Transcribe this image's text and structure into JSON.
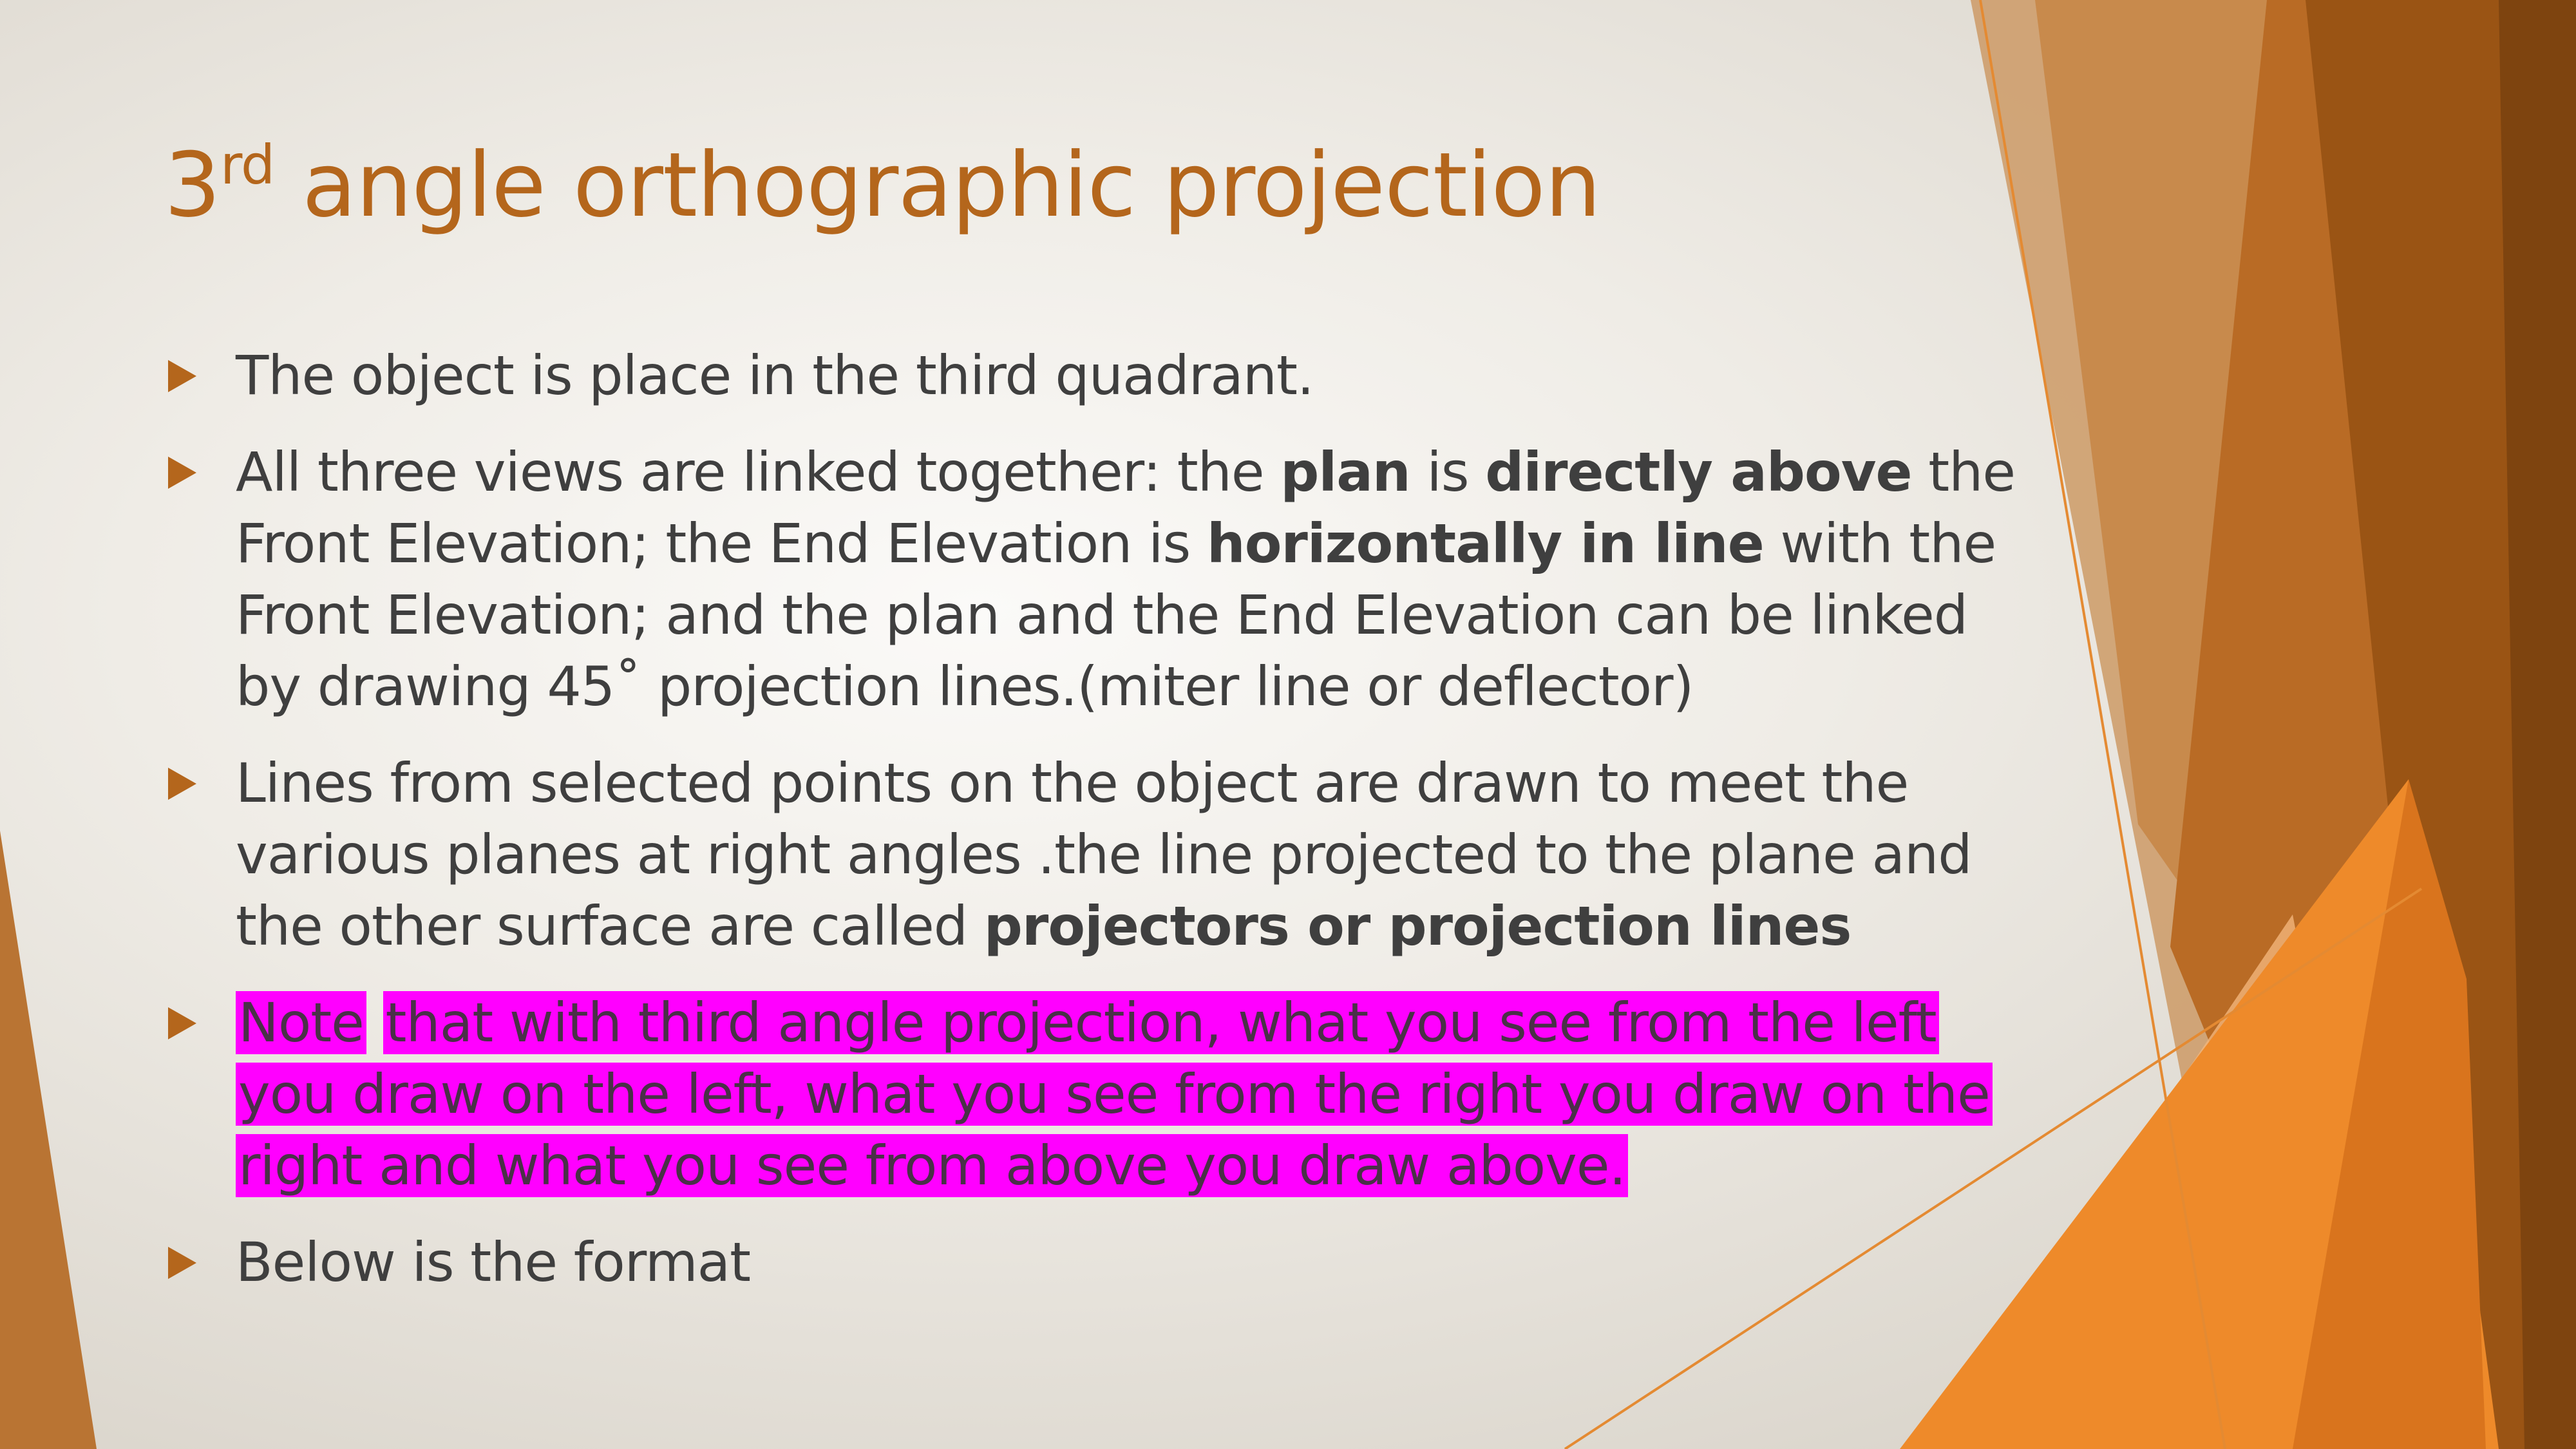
{
  "slide": {
    "title": {
      "prefix": "3",
      "superscript": "rd",
      "rest": " angle orthographic projection"
    },
    "bullets": {
      "b1": {
        "text": "The object is place in the third quadrant."
      },
      "b2": {
        "t1": "All three views are linked together: the ",
        "b1": "plan",
        "t2": " is ",
        "b2": "directly above",
        "t3": " the Front Elevation; the End Elevation is ",
        "b3": "horizontally in line",
        "t4": " with the Front Elevation; and the plan and the End Elevation can be linked by drawing 45˚ projection lines.(miter line or deflector)"
      },
      "b3": {
        "t1": "Lines from selected points on the object are drawn to meet the various planes at right angles .the line projected to the plane and the other surface are called ",
        "b1": "projectors or projection lines"
      },
      "b4": {
        "t1": "Note",
        "t2": "that with third angle projection, what you see from the left you draw on the left, what you see from the right you draw on the right and what you see from above you draw above."
      },
      "b5": {
        "text": "Below is the format"
      }
    }
  },
  "colors": {
    "title": "#b4661c",
    "body_text": "#3f3f3f",
    "bullet_marker": "#b4661c",
    "highlight": "#ff00ff",
    "accent_orange": "#ee8a2a",
    "accent_dark": "#9a5414"
  }
}
